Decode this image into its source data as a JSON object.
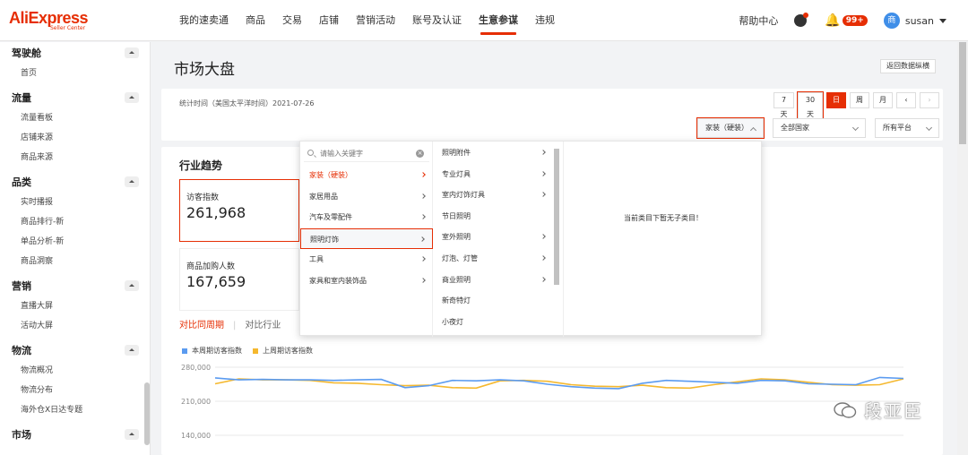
{
  "logo": {
    "name": "AliExpress",
    "sub": "Seller Center"
  },
  "topnav": [
    "我的速卖通",
    "商品",
    "交易",
    "店铺",
    "营销活动",
    "账号及认证",
    "生意参谋",
    "违规"
  ],
  "topnav_active": "生意参谋",
  "topright": {
    "help": "帮助中心",
    "badge": "99+",
    "avatar_text": "商",
    "username": "susan"
  },
  "sidebar": [
    {
      "title": "驾驶舱",
      "items": [
        "首页"
      ]
    },
    {
      "title": "流量",
      "items": [
        "流量看板",
        "店铺来源",
        "商品来源"
      ]
    },
    {
      "title": "品类",
      "items": [
        "实时播报",
        "商品排行-新",
        "单品分析-新",
        "商品洞察"
      ]
    },
    {
      "title": "营销",
      "items": [
        "直播大屏",
        "活动大屏"
      ]
    },
    {
      "title": "物流",
      "items": [
        "物流概况",
        "物流分布",
        "海外仓X日达专题"
      ]
    },
    {
      "title": "市场",
      "items": []
    }
  ],
  "page": {
    "title": "市场大盘",
    "back_button": "返回数据纵横"
  },
  "stat": {
    "time_label": "统计时间（美国太平洋时间）2021-07-26"
  },
  "range_buttons": [
    "7天",
    "30天",
    "日",
    "周",
    "月"
  ],
  "filters": {
    "category": "家装（硬装）",
    "country": "全部国家",
    "platform": "所有平台"
  },
  "trend": {
    "title": "行业趋势",
    "metrics": [
      {
        "label": "访客指数",
        "value": "261,968"
      },
      {
        "label": "商品加购人数",
        "value": "167,659"
      }
    ],
    "compare_tabs": [
      "对比同周期",
      "对比行业"
    ]
  },
  "dropdown": {
    "search_placeholder": "请输入关键字",
    "categories": [
      "家装（硬装）",
      "家居用品",
      "汽车及零配件",
      "照明灯饰",
      "工具",
      "家具和室内装饰品"
    ],
    "subcategories": [
      "照明附件",
      "专业灯具",
      "室内灯饰灯具",
      "节日照明",
      "室外照明",
      "灯泡、灯管",
      "商业照明",
      "新奇特灯",
      "小夜灯"
    ],
    "empty_message": "当前类目下暂无子类目！"
  },
  "chart_data": {
    "type": "line",
    "y_tick_labels": [
      "280,000",
      "210,000",
      "140,000"
    ],
    "series": [
      {
        "name": "本周期访客指数",
        "color": "#5b9bf0",
        "values": [
          258000,
          254000,
          255000,
          254000,
          254000,
          253000,
          254000,
          255000,
          238000,
          242000,
          253000,
          252000,
          254000,
          252000,
          245000,
          240000,
          237000,
          236000,
          247000,
          253000,
          251000,
          249000,
          247000,
          253000,
          252000,
          246000,
          245000,
          244000,
          259000,
          257000
        ]
      },
      {
        "name": "上周期访客指数",
        "color": "#f5b82e",
        "values": [
          246000,
          256000,
          254000,
          254000,
          253000,
          248000,
          247000,
          244000,
          242000,
          243000,
          238000,
          237000,
          252000,
          253000,
          251000,
          244000,
          241000,
          240000,
          243000,
          238000,
          237000,
          244000,
          250000,
          256000,
          254000,
          249000,
          244000,
          243000,
          244000,
          256000
        ]
      }
    ]
  }
}
